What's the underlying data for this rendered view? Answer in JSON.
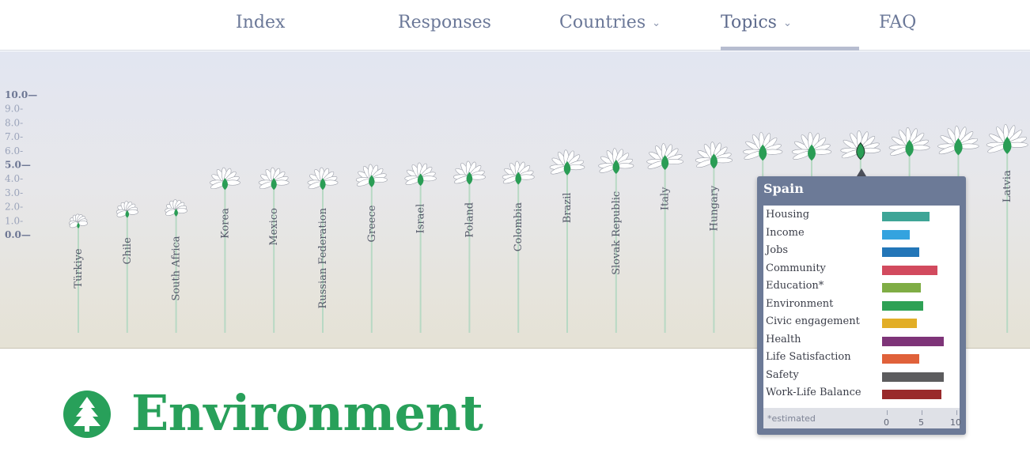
{
  "nav": {
    "items": [
      {
        "label": "Index",
        "dropdown": false
      },
      {
        "label": "Responses",
        "dropdown": false
      },
      {
        "label": "Countries",
        "dropdown": true
      },
      {
        "label": "Topics",
        "dropdown": true,
        "active": true
      },
      {
        "label": "FAQ",
        "dropdown": false
      }
    ]
  },
  "chart_data": {
    "type": "scatter",
    "y_axis_ticks": [
      "10.0",
      "9.0",
      "8.0",
      "7.0",
      "6.0",
      "5.0",
      "4.0",
      "3.0",
      "2.0",
      "1.0",
      "0.0"
    ],
    "ylim": [
      0,
      10
    ],
    "categories": [
      "Türkiye",
      "Chile",
      "South Africa",
      "Korea",
      "Mexico",
      "Russian Federation",
      "Greece",
      "Israel",
      "Poland",
      "Colombia",
      "Brazil",
      "Slovak Republic",
      "Italy",
      "Hungary",
      "",
      "",
      "Spain",
      "",
      "",
      "Latvia"
    ],
    "values": [
      0.6,
      1.4,
      1.5,
      3.5,
      3.5,
      3.5,
      3.7,
      3.8,
      3.9,
      3.9,
      4.6,
      4.7,
      5.0,
      5.1,
      5.7,
      5.7,
      5.8,
      6.0,
      6.1,
      6.2
    ],
    "highlight": "Spain",
    "colors": {
      "stem": "#b8d9c4",
      "flower": "#2a9d55",
      "petal": "#ffffff"
    }
  },
  "tooltip": {
    "country": "Spain",
    "rows": [
      {
        "label": "Housing",
        "value": 6.3,
        "color": "#3ea597"
      },
      {
        "label": "Income",
        "value": 3.6,
        "color": "#34a3df"
      },
      {
        "label": "Jobs",
        "value": 4.9,
        "color": "#2376b8"
      },
      {
        "label": "Community",
        "value": 7.3,
        "color": "#d24a5e"
      },
      {
        "label": "Education*",
        "value": 5.1,
        "color": "#7fad45"
      },
      {
        "label": "Environment",
        "value": 5.4,
        "color": "#2ea155"
      },
      {
        "label": "Civic engagement",
        "value": 4.6,
        "color": "#e2ae27"
      },
      {
        "label": "Health",
        "value": 8.1,
        "color": "#7e3478"
      },
      {
        "label": "Life Satisfaction",
        "value": 4.9,
        "color": "#e0613a"
      },
      {
        "label": "Safety",
        "value": 8.1,
        "color": "#5c5c5e"
      },
      {
        "label": "Work-Life Balance",
        "value": 7.8,
        "color": "#992a2b"
      }
    ],
    "note": "*estimated",
    "scale": [
      "0",
      "5",
      "10"
    ]
  },
  "heading": {
    "title": "Environment",
    "icon": "tree-icon",
    "color": "#28a05a"
  }
}
